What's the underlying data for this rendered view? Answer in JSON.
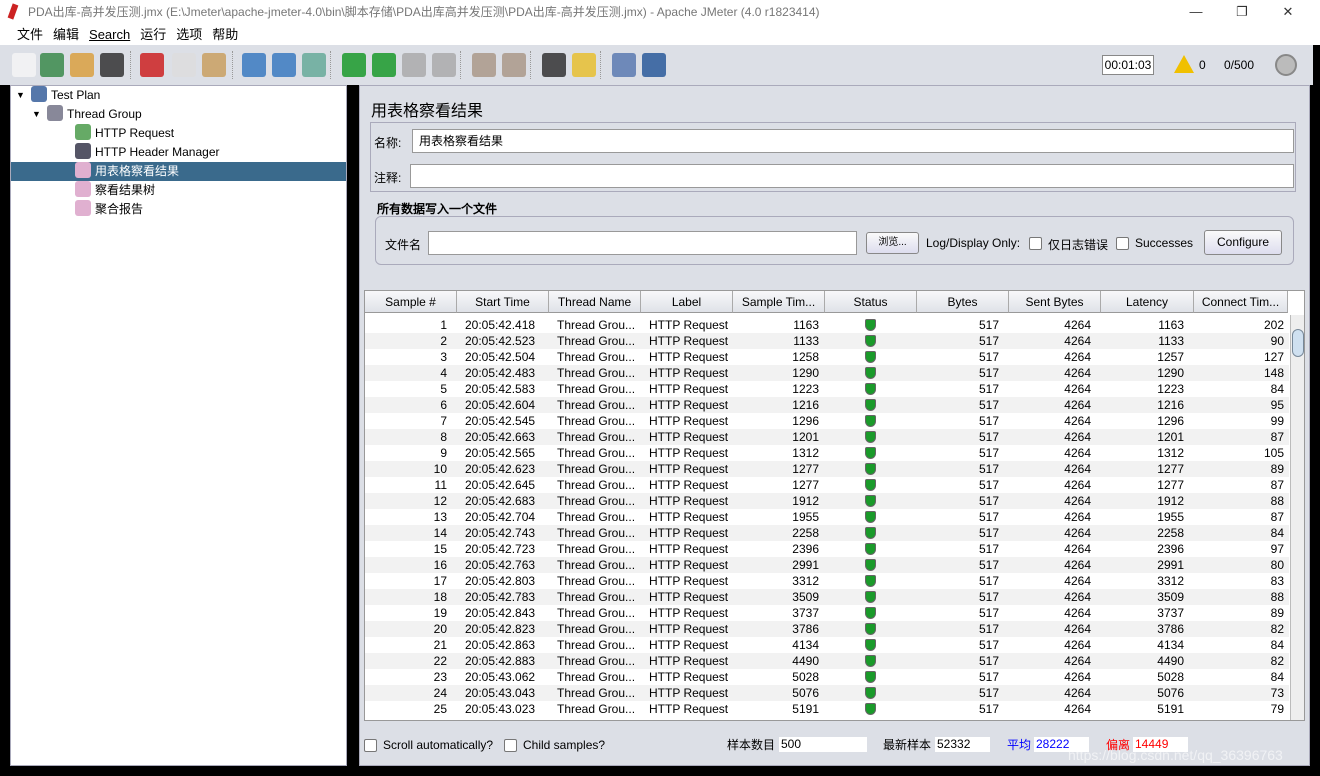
{
  "window": {
    "title": "PDA出库-高并发压测.jmx (E:\\Jmeter\\apache-jmeter-4.0\\bin\\脚本存储\\PDA出库高并发压测\\PDA出库-高并发压测.jmx) - Apache JMeter (4.0 r1823414)",
    "minimize": "—",
    "maximize": "❐",
    "close": "✕"
  },
  "menu": [
    "文件",
    "编辑",
    "Search",
    "运行",
    "选项",
    "帮助"
  ],
  "toolbar": {
    "icons": [
      "new-icon",
      "templates-icon",
      "open-icon",
      "save-icon",
      "cut-icon",
      "copy-icon",
      "paste-icon",
      "expand-icon",
      "collapse-icon",
      "toggle-icon",
      "start-icon",
      "start-no-pause-icon",
      "stop-icon",
      "shutdown-icon",
      "clear-icon",
      "clear-all-icon",
      "search-icon",
      "reset-search-icon",
      "function-helper-icon",
      "help-icon"
    ],
    "elapsed": "00:01:03",
    "warnings": "0",
    "threads": "0/500"
  },
  "tree": [
    {
      "label": "Test Plan",
      "level": 0,
      "icon": "test-plan-icon"
    },
    {
      "label": "Thread Group",
      "level": 1,
      "icon": "gear-icon"
    },
    {
      "label": "HTTP Request",
      "level": 2,
      "icon": "sampler-icon"
    },
    {
      "label": "HTTP Header Manager",
      "level": 2,
      "icon": "tools-icon"
    },
    {
      "label": "用表格察看结果",
      "level": 2,
      "icon": "chart-icon",
      "selected": true
    },
    {
      "label": "察看结果树",
      "level": 2,
      "icon": "chart-icon"
    },
    {
      "label": "聚合报告",
      "level": 2,
      "icon": "chart-icon"
    }
  ],
  "panel": {
    "title": "用表格察看结果",
    "name_label": "名称:",
    "name_value": "用表格察看结果",
    "comment_label": "注释:",
    "comment_value": "",
    "file_section": "所有数据写入一个文件",
    "filename_label": "文件名",
    "filename_value": "",
    "browse": "浏览...",
    "log_display": "Log/Display Only:",
    "errors_only": "仅日志错误",
    "successes": "Successes",
    "configure": "Configure"
  },
  "table": {
    "columns": [
      "Sample #",
      "Start Time",
      "Thread Name",
      "Label",
      "Sample Tim...",
      "Status",
      "Bytes",
      "Sent Bytes",
      "Latency",
      "Connect Tim..."
    ],
    "rows": [
      [
        1,
        "20:05:42.418",
        "Thread Grou...",
        "HTTP Request",
        1163,
        "success",
        517,
        4264,
        1163,
        202
      ],
      [
        2,
        "20:05:42.523",
        "Thread Grou...",
        "HTTP Request",
        1133,
        "success",
        517,
        4264,
        1133,
        90
      ],
      [
        3,
        "20:05:42.504",
        "Thread Grou...",
        "HTTP Request",
        1258,
        "success",
        517,
        4264,
        1257,
        127
      ],
      [
        4,
        "20:05:42.483",
        "Thread Grou...",
        "HTTP Request",
        1290,
        "success",
        517,
        4264,
        1290,
        148
      ],
      [
        5,
        "20:05:42.583",
        "Thread Grou...",
        "HTTP Request",
        1223,
        "success",
        517,
        4264,
        1223,
        84
      ],
      [
        6,
        "20:05:42.604",
        "Thread Grou...",
        "HTTP Request",
        1216,
        "success",
        517,
        4264,
        1216,
        95
      ],
      [
        7,
        "20:05:42.545",
        "Thread Grou...",
        "HTTP Request",
        1296,
        "success",
        517,
        4264,
        1296,
        99
      ],
      [
        8,
        "20:05:42.663",
        "Thread Grou...",
        "HTTP Request",
        1201,
        "success",
        517,
        4264,
        1201,
        87
      ],
      [
        9,
        "20:05:42.565",
        "Thread Grou...",
        "HTTP Request",
        1312,
        "success",
        517,
        4264,
        1312,
        105
      ],
      [
        10,
        "20:05:42.623",
        "Thread Grou...",
        "HTTP Request",
        1277,
        "success",
        517,
        4264,
        1277,
        89
      ],
      [
        11,
        "20:05:42.645",
        "Thread Grou...",
        "HTTP Request",
        1277,
        "success",
        517,
        4264,
        1277,
        87
      ],
      [
        12,
        "20:05:42.683",
        "Thread Grou...",
        "HTTP Request",
        1912,
        "success",
        517,
        4264,
        1912,
        88
      ],
      [
        13,
        "20:05:42.704",
        "Thread Grou...",
        "HTTP Request",
        1955,
        "success",
        517,
        4264,
        1955,
        87
      ],
      [
        14,
        "20:05:42.743",
        "Thread Grou...",
        "HTTP Request",
        2258,
        "success",
        517,
        4264,
        2258,
        84
      ],
      [
        15,
        "20:05:42.723",
        "Thread Grou...",
        "HTTP Request",
        2396,
        "success",
        517,
        4264,
        2396,
        97
      ],
      [
        16,
        "20:05:42.763",
        "Thread Grou...",
        "HTTP Request",
        2991,
        "success",
        517,
        4264,
        2991,
        80
      ],
      [
        17,
        "20:05:42.803",
        "Thread Grou...",
        "HTTP Request",
        3312,
        "success",
        517,
        4264,
        3312,
        83
      ],
      [
        18,
        "20:05:42.783",
        "Thread Grou...",
        "HTTP Request",
        3509,
        "success",
        517,
        4264,
        3509,
        88
      ],
      [
        19,
        "20:05:42.843",
        "Thread Grou...",
        "HTTP Request",
        3737,
        "success",
        517,
        4264,
        3737,
        89
      ],
      [
        20,
        "20:05:42.823",
        "Thread Grou...",
        "HTTP Request",
        3786,
        "success",
        517,
        4264,
        3786,
        82
      ],
      [
        21,
        "20:05:42.863",
        "Thread Grou...",
        "HTTP Request",
        4134,
        "success",
        517,
        4264,
        4134,
        84
      ],
      [
        22,
        "20:05:42.883",
        "Thread Grou...",
        "HTTP Request",
        4490,
        "success",
        517,
        4264,
        4490,
        82
      ],
      [
        23,
        "20:05:43.062",
        "Thread Grou...",
        "HTTP Request",
        5028,
        "success",
        517,
        4264,
        5028,
        84
      ],
      [
        24,
        "20:05:43.043",
        "Thread Grou...",
        "HTTP Request",
        5076,
        "success",
        517,
        4264,
        5076,
        73
      ],
      [
        25,
        "20:05:43.023",
        "Thread Grou...",
        "HTTP Request",
        5191,
        "success",
        517,
        4264,
        5191,
        79
      ]
    ]
  },
  "footer": {
    "scroll_auto": "Scroll automatically?",
    "child_samples": "Child samples?",
    "count_label": "样本数目",
    "count": "500",
    "latest_label": "最新样本",
    "latest": "52332",
    "avg_label": "平均",
    "avg": "28222",
    "dev_label": "偏离",
    "dev": "14449",
    "avg_color": "#0000ff",
    "dev_color": "#ff0000"
  },
  "watermark": "https://blog.csdn.net/qq_36396763"
}
